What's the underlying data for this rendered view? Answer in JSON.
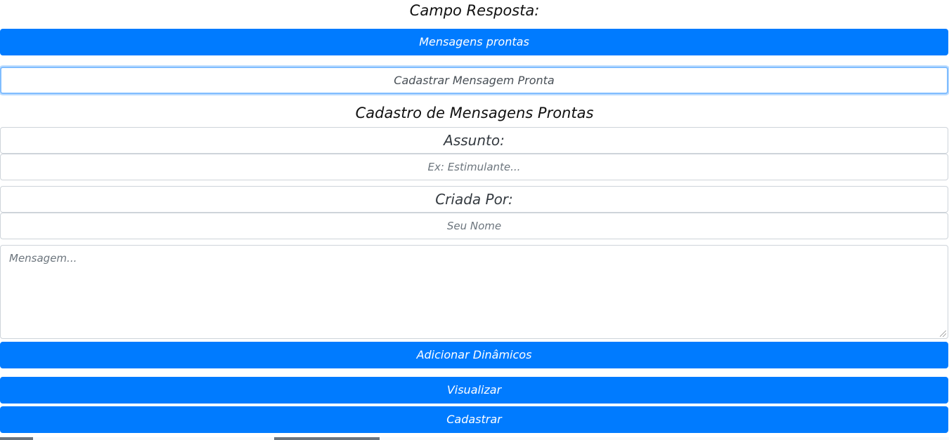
{
  "header": {
    "title": "Campo Resposta:"
  },
  "buttons": {
    "mensagens_prontas": "Mensagens prontas",
    "cadastrar_mensagem_pronta": "Cadastrar Mensagem Pronta",
    "adicionar_dinamicos": "Adicionar Dinâmicos",
    "visualizar": "Visualizar",
    "cadastrar": "Cadastrar"
  },
  "form": {
    "title": "Cadastro de Mensagens Prontas",
    "assunto": {
      "label": "Assunto:",
      "placeholder": "Ex: Estimulante..."
    },
    "criada_por": {
      "label": "Criada Por:",
      "placeholder": "Seu Nome"
    },
    "mensagem": {
      "placeholder": "Mensagem..."
    }
  },
  "colors": {
    "primary": "#007bff",
    "focus_border": "#80bdff",
    "input_border": "#ced4da"
  }
}
